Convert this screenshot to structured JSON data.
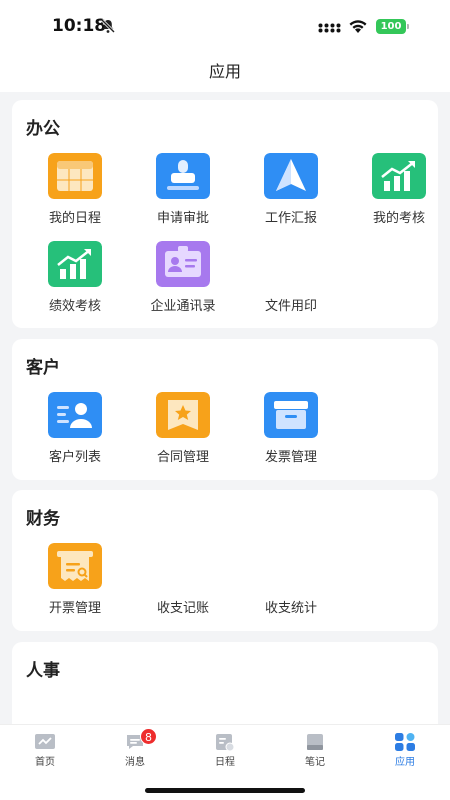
{
  "status": {
    "time": "10:18",
    "battery": "100",
    "battery_color": "#34c759"
  },
  "nav": {
    "title": "应用"
  },
  "sections": [
    {
      "title": "办公",
      "apps": [
        {
          "label": "我的日程",
          "icon": "calendar-icon",
          "color": "#f7a21a"
        },
        {
          "label": "申请审批",
          "icon": "stamp-icon",
          "color": "#2f8ef4"
        },
        {
          "label": "工作汇报",
          "icon": "paper-plane-icon",
          "color": "#2f8ef4"
        },
        {
          "label": "我的考核",
          "icon": "growth-chart-icon",
          "color": "#26c07a"
        },
        {
          "label": "绩效考核",
          "icon": "growth-chart-icon",
          "color": "#26c07a"
        },
        {
          "label": "企业通讯录",
          "icon": "contact-card-icon",
          "color": "#a779ee"
        },
        {
          "label": "文件用印"
        }
      ]
    },
    {
      "title": "客户",
      "apps": [
        {
          "label": "客户列表",
          "icon": "customer-icon",
          "color": "#2f8ef4"
        },
        {
          "label": "合同管理",
          "icon": "contract-icon",
          "color": "#f7a21a"
        },
        {
          "label": "发票管理",
          "icon": "invoice-box-icon",
          "color": "#2f8ef4"
        }
      ]
    },
    {
      "title": "财务",
      "apps": [
        {
          "label": "开票管理",
          "icon": "receipt-icon",
          "color": "#f7a21a"
        },
        {
          "label": "收支记账"
        },
        {
          "label": "收支统计"
        }
      ]
    },
    {
      "title": "人事",
      "apps": []
    }
  ],
  "tabs": [
    {
      "label": "首页",
      "icon": "home-chart-icon"
    },
    {
      "label": "消息",
      "icon": "message-icon",
      "badge": "8"
    },
    {
      "label": "日程",
      "icon": "schedule-icon"
    },
    {
      "label": "笔记",
      "icon": "notebook-icon"
    },
    {
      "label": "应用",
      "icon": "apps-grid-icon",
      "active": true
    }
  ],
  "colors": {
    "accent": "#2d7de3",
    "badge": "#ee2d2d",
    "background": "#f3f4f6"
  }
}
